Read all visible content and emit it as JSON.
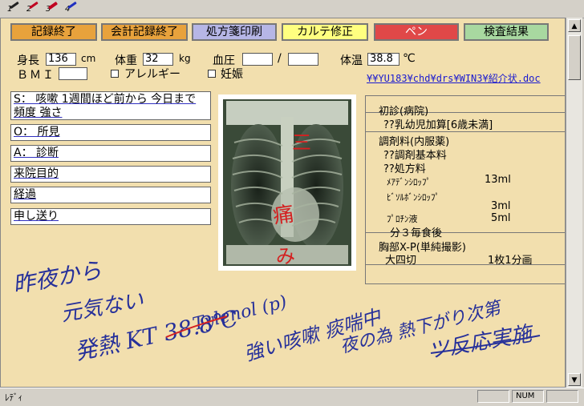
{
  "pens": [
    {
      "label": "1",
      "name": "pen-black"
    },
    {
      "label": "2",
      "name": "pen-red"
    },
    {
      "label": "3",
      "name": "pen-red-thick"
    },
    {
      "label": "4",
      "name": "pen-blue"
    }
  ],
  "toolbar": {
    "record_end": "記録終了",
    "account_record_end": "会計記録終了",
    "prescription_print": "処方箋印刷",
    "chart_fix": "カルテ修正",
    "pen": "ペン",
    "test_results": "検査結果"
  },
  "colors": {
    "btn_orange": "#e8a23c",
    "btn_blue": "#b6b6e6",
    "btn_yellow": "#ffff80",
    "btn_red": "#e04848",
    "btn_green": "#a8d8a0",
    "chart_bg": "#f2dfae",
    "link": "#1a1ad0"
  },
  "vitals": {
    "height_label": "身長",
    "height_value": "136",
    "height_unit": "cm",
    "weight_label": "体重",
    "weight_value": "32",
    "weight_unit": "kg",
    "bp_label": "血圧",
    "bp_sep": "/",
    "temp_label": "体温",
    "temp_value": "38.8",
    "temp_unit": "℃",
    "bmi_label": "ＢＭＩ",
    "allergy_label": "アレルギー",
    "pregnancy_label": "妊娠"
  },
  "referral_link": "¥¥YU183¥chd¥drs¥WIN3¥紹介状.doc",
  "soap": {
    "s_line1": "S： 咳嗽 1週間ほど前から 今日まで 頻度 強さ",
    "o_line": "O： 所見",
    "a_line": "A： 診断",
    "reason": "来院目的",
    "course": "経過",
    "handover": "申し送り"
  },
  "orders": {
    "r1": "初診(病院)",
    "r2": "??乳幼児加算[6歳未満]",
    "r3": "調剤料(内服薬)",
    "r4": "??調剤基本料",
    "r5": "??処方料",
    "r6a": "ﾒｱﾃﾞﾝｼﾛｯﾌﾟ",
    "r6b": "13ml",
    "r7": "ﾋﾞｿﾙﾎﾞﾝｼﾛｯﾌﾟ",
    "r8": "3ml",
    "r9a": "ﾌﾟﾛﾁﾝ液",
    "r9b": "5ml",
    "r10": "分３毎食後",
    "r11": "胸部X-P(単純撮影)",
    "r12a": "大四切",
    "r12b": "1枚1分画"
  },
  "handwriting": {
    "line1": "昨夜から",
    "line2": "元気ない",
    "line3": "発熱 KT 38.8℃",
    "line4": "Tylenol (p)",
    "line5": "強い咳嗽 痰喘中",
    "line6": "夜の為 熱下がり次第",
    "line7": "ツ反応実施"
  },
  "xray_annotations": {
    "mark1": "三",
    "mark2": "痛",
    "mark3": "み"
  },
  "status": {
    "text": "ﾚﾃﾞｨ",
    "num": "NUM"
  }
}
